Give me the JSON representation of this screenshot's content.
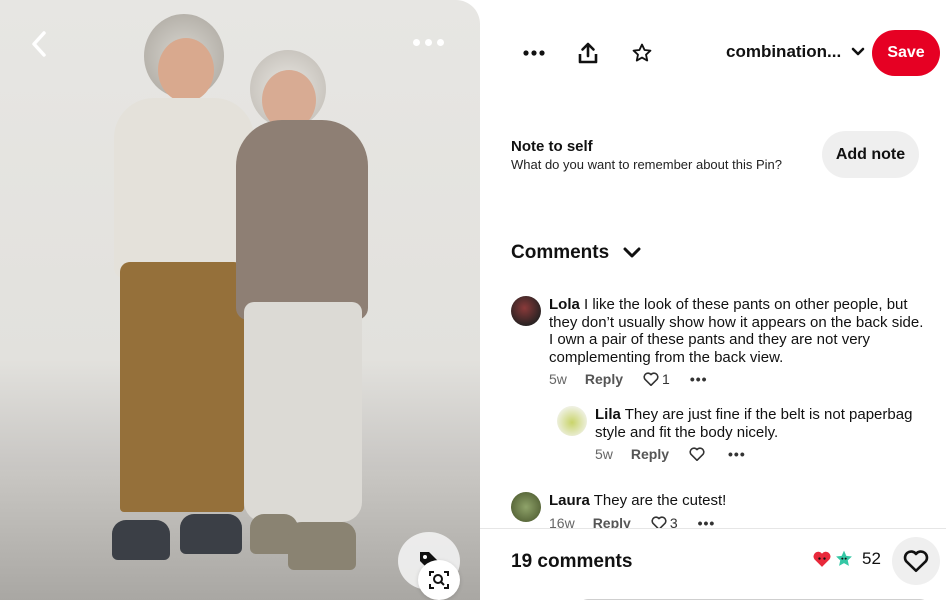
{
  "toolbar": {
    "more_icon": "more-horizontal-icon",
    "share_icon": "share-upload-icon",
    "star_icon": "star-outline-icon",
    "board_name": "combination...",
    "save_label": "Save",
    "save_color": "#e60023"
  },
  "note": {
    "title": "Note to self",
    "subtitle": "What do you want to remember about this Pin?",
    "button": "Add note"
  },
  "comments": {
    "header": "Comments",
    "items": [
      {
        "author": "Lola",
        "text": "I like the look of these pants on other people, but they don’t usually show how it appears on the back side. I own a pair of these pants and they are not very complementing from the back view.",
        "age": "5w",
        "reply": "Reply",
        "likes": "1"
      },
      {
        "author": "Lila",
        "text": "They are just fine if the belt is not paperbag style and fit the body nicely.",
        "age": "5w",
        "reply": "Reply",
        "likes": ""
      },
      {
        "author": "Laura",
        "text": "They are the cutest!",
        "age": "16w",
        "reply": "Reply",
        "likes": "3"
      }
    ]
  },
  "footer": {
    "count": "19 comments",
    "reaction_count": "52"
  }
}
